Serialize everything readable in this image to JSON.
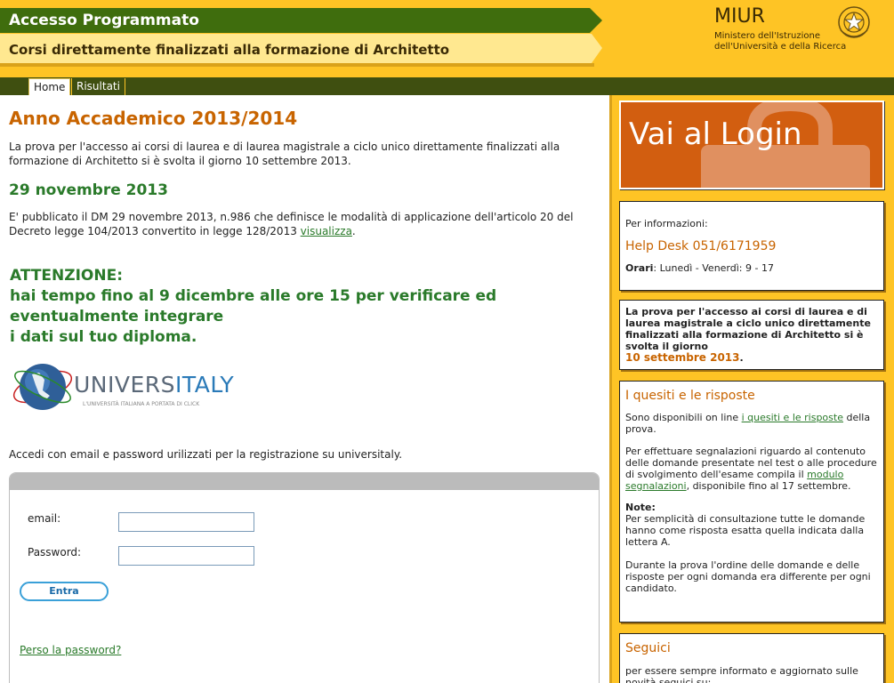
{
  "header": {
    "title": "Accesso Programmato",
    "subtitle": "Corsi direttamente finalizzati alla formazione di Architetto",
    "miur": "MIUR",
    "miur_line1": "Ministero dell'Istruzione",
    "miur_line2": "dell'Università e della Ricerca"
  },
  "nav": {
    "tabs": [
      {
        "label": "Home"
      },
      {
        "label": "Risultati"
      }
    ]
  },
  "main": {
    "heading": "Anno Accademico 2013/2014",
    "intro": "La prova per l'accesso ai corsi di laurea e di laurea magistrale a ciclo unico direttamente finalizzati alla formazione di Architetto si è svolta il giorno 10 settembre 2013.",
    "date_heading": "29 novembre 2013",
    "news_text": "E' pubblicato il DM 29 novembre 2013, n.986 che definisce le modalità di applicazione dell'articolo 20 del Decreto legge 104/2013 convertito in legge 128/2013 ",
    "news_link": "visualizza",
    "news_end": ".",
    "attention_1": "ATTENZIONE:",
    "attention_2": "hai tempo fino al 9 dicembre alle ore 15 per verificare ed",
    "attention_3": "eventualmente integrare",
    "attention_4": "i dati sul tuo diploma.",
    "logo_a": "UNIVERS",
    "logo_b": "ITALY",
    "logo_tagline": "L'UNIVERSITÀ ITALIANA A PORTATA DI CLICK",
    "login_intro": "Accedi con email e password urilizzati per la registrazione su universitaly."
  },
  "login": {
    "email_label": "email:",
    "password_label": "Password:",
    "email_value": "",
    "password_value": "",
    "submit_label": "Entra",
    "lost_password": "Perso la password?"
  },
  "sidebar": {
    "login_banner": "Vai al Login",
    "info_label": "Per informazioni:",
    "helpdesk": "Help Desk 051/6171959",
    "hours_label": "Orari",
    "hours_value": ": Lunedì - Venerdì: 9 - 17",
    "exam_text": "La prova per l'accesso ai corsi di laurea e di laurea magistrale a ciclo unico direttamente finalizzati alla formazione di Architetto si è svolta il giorno",
    "exam_date": "10 settembre 2013",
    "exam_end": ".",
    "quesiti_title": "I quesiti e le risposte",
    "quesiti_p1a": "Sono disponibili on line ",
    "quesiti_p1_link": "i quesiti e le risposte",
    "quesiti_p1b": " della prova.",
    "quesiti_p2a": "Per effettuare segnalazioni riguardo al contenuto delle domande presentate nel test o alle procedure di svolgimento dell'esame compila il ",
    "quesiti_p2_link": "modulo segnalazioni",
    "quesiti_p2b": ", disponibile fino al 17 settembre.",
    "note_label": "Note:",
    "note_text": "Per semplicità di consultazione tutte le domande hanno come risposta esatta quella indicata dalla lettera A.",
    "note_text2": "Durante la prova l'ordine delle domande e delle risposte per ogni domanda era differente per ogni candidato.",
    "seguici_title": "Seguici",
    "seguici_text": "per essere sempre informato e aggiornato sulle novità seguici su:"
  }
}
